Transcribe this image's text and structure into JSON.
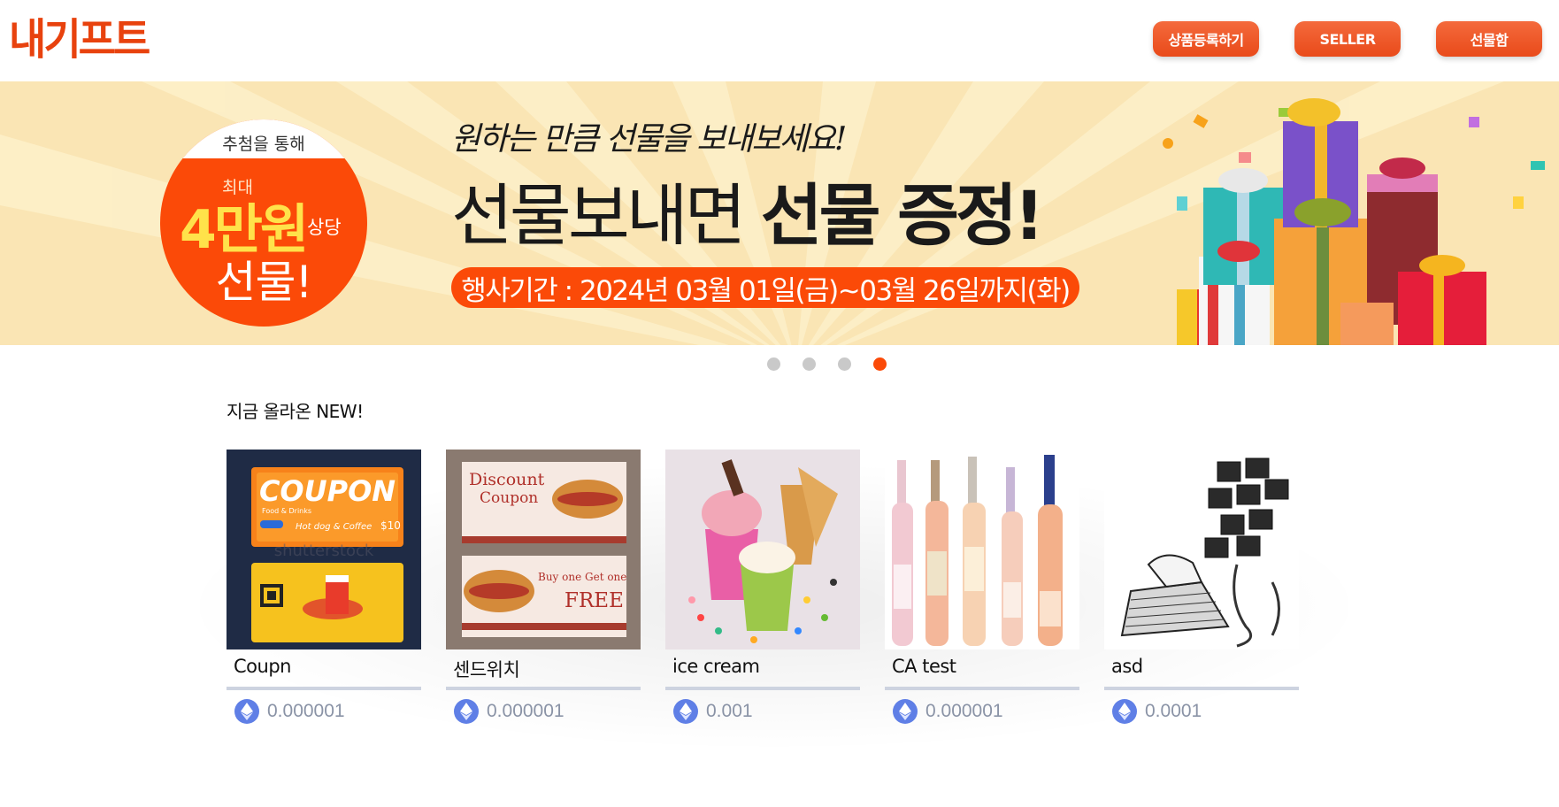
{
  "header": {
    "logo": "내기프트",
    "buttons": [
      "상품등록하기",
      "SELLER",
      "선물함"
    ]
  },
  "banner": {
    "circle_top": "추첨을 통해",
    "circle_small": "최대",
    "circle_amount": "4만원",
    "circle_unit": "상당",
    "circle_gift": "선물!",
    "subtitle": "원하는 만큼 선물을 보내보세요!",
    "headline_light": "선물보내면 ",
    "headline_bold": "선물 증정!",
    "period": "행사기간 : 2024년 03월 01일(금)~03월 26일까지(화)"
  },
  "carousel": {
    "count": 4,
    "active_index": 3
  },
  "section": {
    "title": "지금 올라온 NEW!"
  },
  "products": [
    {
      "name": "Coupn",
      "price": "0.000001",
      "icon": "ethereum-icon"
    },
    {
      "name": "센드위치",
      "price": "0.000001",
      "icon": "ethereum-icon"
    },
    {
      "name": "ice cream",
      "price": "0.001",
      "icon": "ethereum-icon"
    },
    {
      "name": "CA test",
      "price": "0.000001",
      "icon": "ethereum-icon"
    },
    {
      "name": "asd",
      "price": "0.0001",
      "icon": "ethereum-icon"
    }
  ],
  "image_text": {
    "coupon_title": "COUPON",
    "coupon_sub": "Food & Drinks",
    "coupon_item": "Hot dog & Coffee",
    "coupon_price": "$10",
    "coupon_watermark": "shutterstock",
    "sandwich_title1": "Discount",
    "sandwich_title2": "Coupon",
    "sandwich_offer1": "Buy one Get one",
    "sandwich_offer2": "FREE"
  },
  "colors": {
    "accent": "#fb4a08",
    "logo": "#e8420e",
    "banner_bg": "#fae5b4",
    "divider": "#cdd3e0",
    "price": "#8a93a6",
    "eth": "#5f7fe6"
  }
}
